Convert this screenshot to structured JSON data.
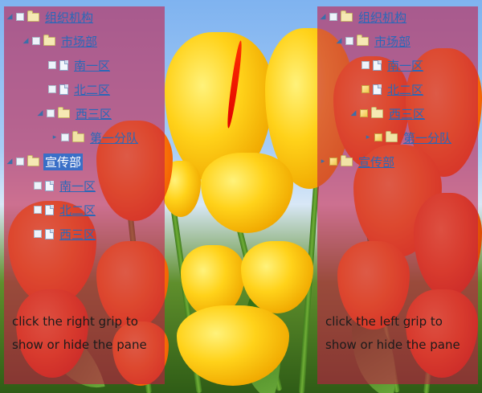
{
  "tree": {
    "root": "组织机构",
    "market": "市场部",
    "south": "南一区",
    "north": "北二区",
    "west": "西三区",
    "squad": "第一分队",
    "promo": "宣传部",
    "promo_south": "南一区",
    "promo_north": "北二区",
    "promo_west": "西三区"
  },
  "left_pane": {
    "hint": "click the right grip to show or hide the pane"
  },
  "right_pane": {
    "hint": "click the left grip to show or hide the pane"
  }
}
